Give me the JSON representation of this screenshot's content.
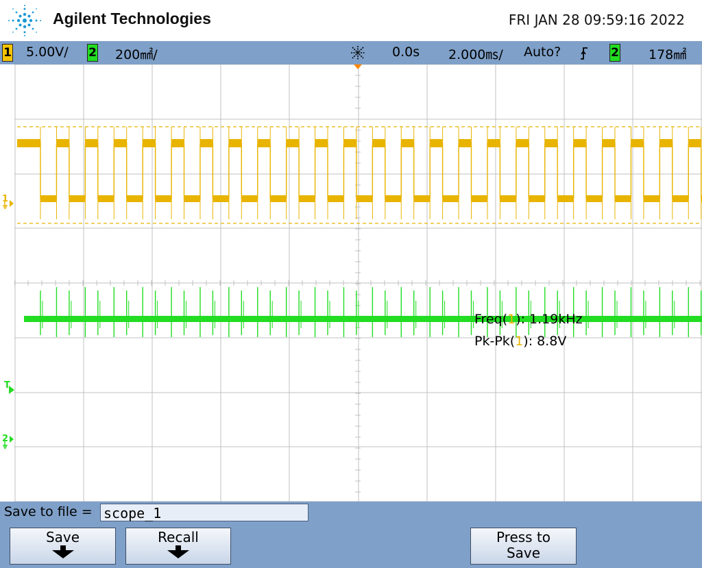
{
  "header": {
    "brand": "Agilent Technologies",
    "datetime": "FRI JAN 28 09:59:16 2022"
  },
  "statusbar": {
    "ch1_num": "1",
    "ch1_scale": "5.00V/",
    "ch2_num": "2",
    "ch2_scale": "200㎟/",
    "run_icon": "asterisk-icon",
    "delay": "0.0s",
    "timebase": "2.000㎳/",
    "trigger_mode": "Auto?",
    "trigger_edge": "ʃ",
    "trig_source": "2",
    "trig_level": "178㎟"
  },
  "colors": {
    "ch1": "#e8b400",
    "ch2": "#22dd22",
    "grid": "#c0c0c0",
    "bar": "#7fa0c8",
    "trigger_marker": "#ff8800"
  },
  "markers": {
    "ch1": "1",
    "trigger": "T",
    "ch2": "2"
  },
  "measurements": {
    "freq_label": "Freq(",
    "freq_ch": "1",
    "freq_value": "): 1.19kHz",
    "pkpk_label": "Pk-Pk(",
    "pkpk_ch": "1",
    "pkpk_value": "): 8.8V"
  },
  "softkeys": {
    "save_to_file_label": "Save to file =",
    "filename": "scope_1",
    "save_label": "Save",
    "recall_label": "Recall",
    "press_to_save_line1": "Press to",
    "press_to_save_line2": "Save"
  }
}
